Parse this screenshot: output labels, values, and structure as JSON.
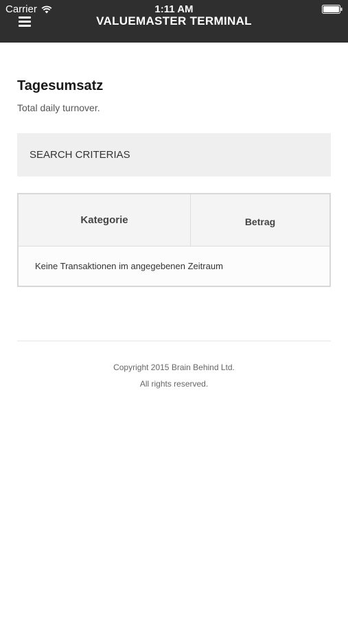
{
  "status_bar": {
    "carrier": "Carrier",
    "time": "1:11 AM",
    "wifi_icon": "wifi-icon",
    "battery_icon": "battery-icon"
  },
  "navbar": {
    "menu_icon": "hamburger-menu-icon",
    "title": "VALUEMASTER TERMINAL",
    "background_color": "#2f2f2f"
  },
  "page": {
    "title": "Tagesumsatz",
    "subtitle": "Total daily turnover."
  },
  "search": {
    "label": "SEARCH CRITERIAS"
  },
  "table": {
    "columns": [
      "Kategorie",
      "Betrag"
    ],
    "empty_message": "Keine Transaktionen im angegebenen Zeitraum"
  },
  "footer": {
    "copyright": "Copyright 2015 Brain Behind Ltd.",
    "rights": "All rights reserved."
  }
}
